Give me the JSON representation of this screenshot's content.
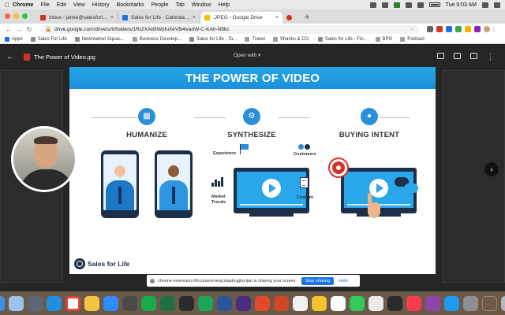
{
  "menubar": {
    "items": [
      "Chrome",
      "File",
      "Edit",
      "View",
      "History",
      "Bookmarks",
      "People",
      "Tab",
      "Window",
      "Help"
    ],
    "clock": "Tue 9:03 AM"
  },
  "tabs": [
    {
      "label": "Inbox - jamie@salesforlife.com",
      "color": "#d93025",
      "active": false
    },
    {
      "label": "Sales for Life - Calendar - Eve",
      "color": "#1a73e8",
      "active": false
    },
    {
      "label": ".JPEG - Google Drive",
      "color": "#fbbc04",
      "active": true
    }
  ],
  "url": "drive.google.com/drive/u/0/folders/1RrZXAb5WbfuXeVB4ivaoW-C-KAh-N9bc",
  "bookmarks": [
    "Apps",
    "Sales For Life",
    "Newmarket Squas...",
    "Business Develop...",
    "Sales for Life - To...",
    "Travel",
    "Shanks & CO.",
    "Sales for Life - Fin...",
    "BPO",
    "Podcast"
  ],
  "viewer": {
    "file_name": "The Power of Video.jpg",
    "open_with": "Open with"
  },
  "slide": {
    "title": "THE POWER OF VIDEO",
    "columns": [
      {
        "title": "HUMANIZE",
        "icon": "chat-icon"
      },
      {
        "title": "SYNTHESIZE",
        "icon": "gear-icon"
      },
      {
        "title": "BUYING INTENT",
        "icon": "lightbulb-icon"
      }
    ],
    "labels": {
      "experience": "Experience",
      "customers": "Customers",
      "market_trends": "Market\nTrends",
      "content": "Content"
    },
    "logo": "Sales for Life"
  },
  "sharing": {
    "message": "chrome-extension://ihcciniecimeajcnlapbngjbonjan is sharing your screen.",
    "stop": "Stop sharing",
    "hide": "Hide"
  },
  "colors": {
    "accent": "#2a8fd6",
    "navy": "#1c2e48"
  }
}
